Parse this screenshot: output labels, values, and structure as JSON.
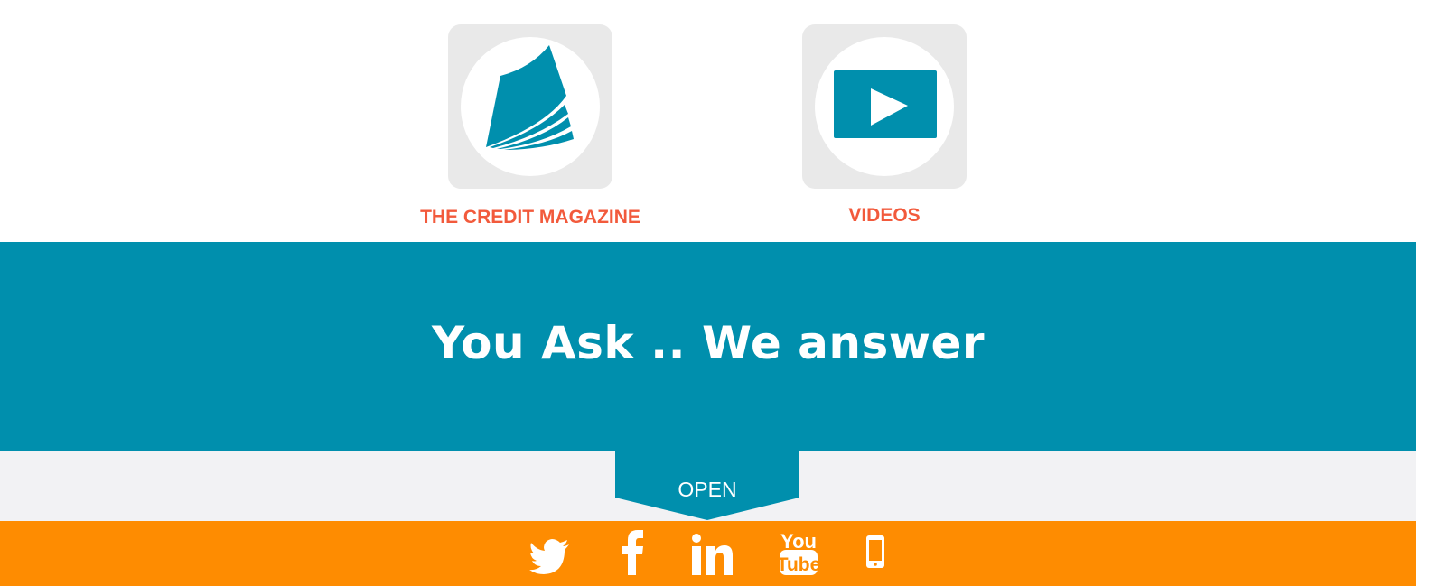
{
  "features": [
    {
      "label": "THE CREDIT MAGAZINE",
      "icon": "magazine-icon"
    },
    {
      "label": "VIDEOS",
      "icon": "video-play-icon"
    }
  ],
  "banner": {
    "heading": "You Ask .. We answer"
  },
  "open_tab": {
    "label": "OPEN"
  },
  "social": [
    "twitter-icon",
    "facebook-icon",
    "linkedin-icon",
    "youtube-icon",
    "mobile-phone-icon"
  ],
  "colors": {
    "accent_teal": "#008fad",
    "label_red": "#f25a3c",
    "footer_orange": "#fe8c01",
    "tile_grey": "#e9e9e9",
    "section_grey": "#f2f2f4"
  }
}
